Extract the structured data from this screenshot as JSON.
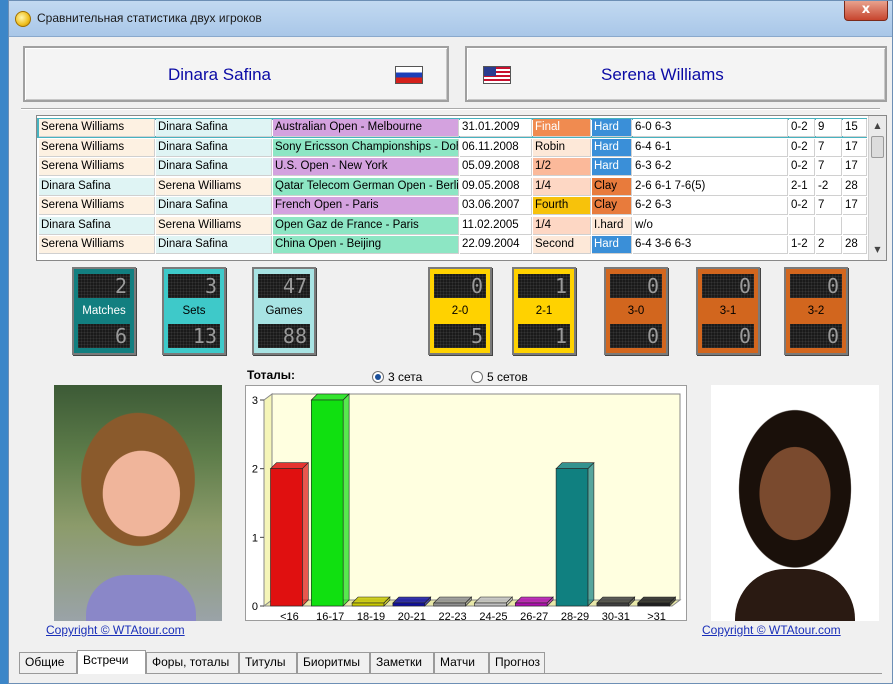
{
  "window": {
    "title": "Сравнительная статистика двух игроков",
    "close_label": "x"
  },
  "players": {
    "left": {
      "name": "Dinara Safina",
      "flag": "russia-flag"
    },
    "right": {
      "name": "Serena Williams",
      "flag": "usa-flag"
    }
  },
  "matches": [
    [
      "Serena Williams",
      "Dinara Safina",
      "Australian Open - Melbourne",
      "31.01.2009",
      "Final",
      "Hard",
      "6-0 6-3",
      "0-2",
      "9",
      "15"
    ],
    [
      "Serena Williams",
      "Dinara Safina",
      "Sony Ericsson Championships - Doha",
      "06.11.2008",
      "Robin",
      "Hard",
      "6-4 6-1",
      "0-2",
      "7",
      "17"
    ],
    [
      "Serena Williams",
      "Dinara Safina",
      "U.S. Open - New York",
      "05.09.2008",
      "1/2",
      "Hard",
      "6-3 6-2",
      "0-2",
      "7",
      "17"
    ],
    [
      "Dinara Safina",
      "Serena Williams",
      "Qatar Telecom German Open - Berlin",
      "09.05.2008",
      "1/4",
      "Clay",
      "2-6 6-1 7-6(5)",
      "2-1",
      "-2",
      "28"
    ],
    [
      "Serena Williams",
      "Dinara Safina",
      "French Open - Paris",
      "03.06.2007",
      "Fourth",
      "Clay",
      "6-2 6-3",
      "0-2",
      "7",
      "17"
    ],
    [
      "Dinara Safina",
      "Serena Williams",
      "Open Gaz de France - Paris",
      "11.02.2005",
      "1/4",
      "I.hard",
      "w/o",
      "",
      "",
      ""
    ],
    [
      "Serena Williams",
      "Dinara Safina",
      "China Open - Beijing",
      "22.09.2004",
      "Second",
      "Hard",
      "6-4 3-6 6-3",
      "1-2",
      "2",
      "28"
    ]
  ],
  "stats": [
    {
      "label": "Matches",
      "top": "2",
      "bottom": "6",
      "color": "#127f80"
    },
    {
      "label": "Sets",
      "top": "3",
      "bottom": "13",
      "color": "#3ec9c9"
    },
    {
      "label": "Games",
      "top": "47",
      "bottom": "88",
      "color": "#a8e3e3"
    },
    {
      "label": "2-0",
      "top": "0",
      "bottom": "5",
      "color": "#ffd200"
    },
    {
      "label": "2-1",
      "top": "1",
      "bottom": "1",
      "color": "#ffd200"
    },
    {
      "label": "3-0",
      "top": "0",
      "bottom": "0",
      "color": "#d2661e"
    },
    {
      "label": "3-1",
      "top": "0",
      "bottom": "0",
      "color": "#d2661e"
    },
    {
      "label": "3-2",
      "top": "0",
      "bottom": "0",
      "color": "#d2661e"
    }
  ],
  "totals": {
    "label": "Тоталы:",
    "option_3": "3 сета",
    "option_5": "5 сетов",
    "selected": "3 сета"
  },
  "chart_data": {
    "type": "bar",
    "categories": [
      "<16",
      "16-17",
      "18-19",
      "20-21",
      "22-23",
      "24-25",
      "26-27",
      "28-29",
      "30-31",
      ">31"
    ],
    "values": [
      2,
      3,
      0,
      0,
      0,
      0,
      0,
      2,
      0,
      0
    ],
    "colors": [
      "#e01010",
      "#10e010",
      "#c8c800",
      "#1010a0",
      "#909090",
      "#c0c0c0",
      "#b010b0",
      "#108080",
      "#404040",
      "#202020"
    ],
    "ylim": [
      0,
      3
    ],
    "yticks": [
      "0",
      "1",
      "2",
      "3"
    ],
    "background": "#ffffe0",
    "grid": false
  },
  "copyright": {
    "left": "Copyright © WTAtour.com",
    "right": "Copyright © WTAtour.com"
  },
  "tabs": [
    "Общие",
    "Встречи",
    "Форы, тоталы",
    "Титулы",
    "Биоритмы",
    "Заметки",
    "Матчи",
    "Прогноз"
  ],
  "active_tab": "Встречи"
}
